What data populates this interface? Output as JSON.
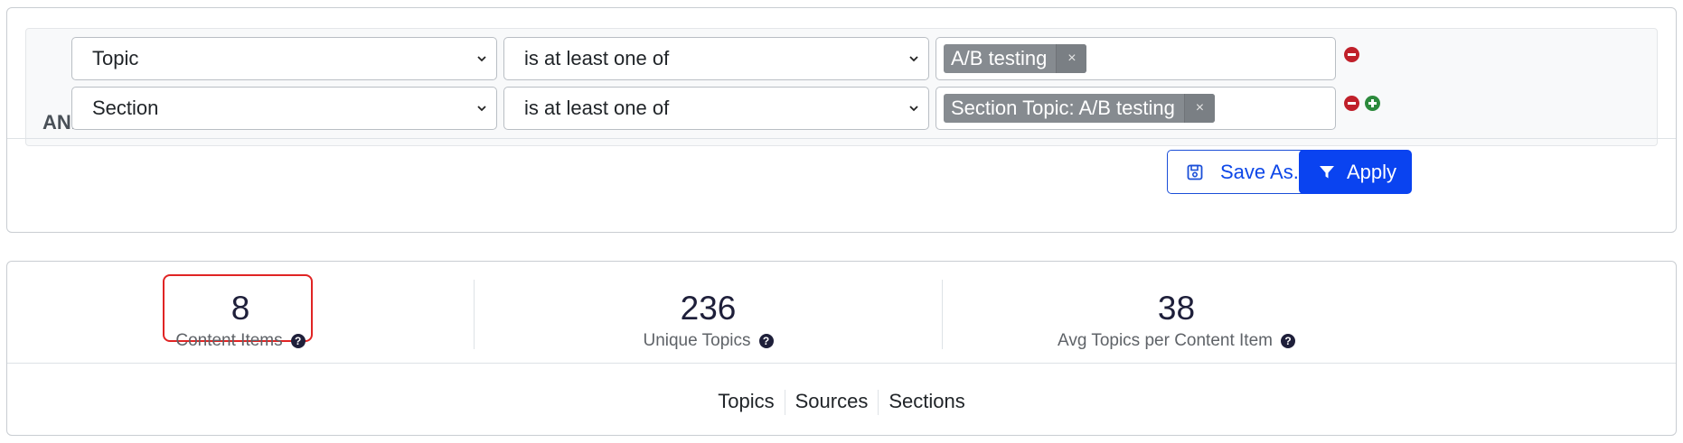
{
  "filters": {
    "rows": [
      {
        "connector": "",
        "field": "Topic",
        "operator": "is at least one of",
        "tag": "A/B testing",
        "tag_remove": "×"
      },
      {
        "connector": "AND",
        "field": "Section",
        "operator": "is at least one of",
        "tag": "Section Topic: A/B testing",
        "tag_remove": "×"
      }
    ]
  },
  "actions": {
    "save_as_label": "Save As...",
    "apply_label": "Apply"
  },
  "stats": [
    {
      "value": "8",
      "label": "Content Items",
      "help": "?"
    },
    {
      "value": "236",
      "label": "Unique Topics",
      "help": "?"
    },
    {
      "value": "38",
      "label": "Avg Topics per Content Item",
      "help": "?"
    }
  ],
  "tabs": [
    "Topics",
    "Sources",
    "Sections"
  ],
  "colors": {
    "primary": "#0a43f0",
    "remove": "#c0202a",
    "add": "#2c8a3c",
    "highlight": "#e02424"
  },
  "icons": [
    "chevron-down-icon",
    "remove-circle-icon",
    "add-circle-icon",
    "save-icon",
    "filter-icon",
    "help-icon"
  ]
}
